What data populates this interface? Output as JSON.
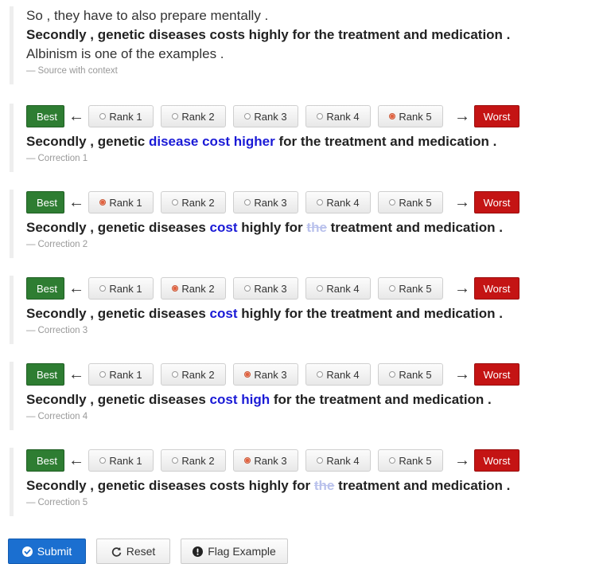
{
  "source": {
    "lines": [
      "So , they have to also prepare mentally .",
      "Secondly , genetic diseases costs highly for the treatment and medication .",
      "Albinism is one of the examples ."
    ],
    "footer": "Source with context"
  },
  "rank_labels": {
    "best": "Best",
    "worst": "Worst",
    "left_arrow": "←",
    "right_arrow": "→",
    "options": [
      "Rank 1",
      "Rank 2",
      "Rank 3",
      "Rank 4",
      "Rank 5"
    ]
  },
  "corrections": [
    {
      "footer": "Correction 1",
      "selected_rank": 5,
      "segments": [
        {
          "t": "Secondly , genetic ",
          "s": "n"
        },
        {
          "t": "disease cost higher",
          "s": "ins"
        },
        {
          "t": " for the treatment and medication .",
          "s": "n"
        }
      ]
    },
    {
      "footer": "Correction 2",
      "selected_rank": 1,
      "segments": [
        {
          "t": "Secondly , genetic diseases ",
          "s": "n"
        },
        {
          "t": "cost",
          "s": "ins"
        },
        {
          "t": " highly for ",
          "s": "n"
        },
        {
          "t": "the",
          "s": "del"
        },
        {
          "t": " treatment and medication .",
          "s": "n"
        }
      ]
    },
    {
      "footer": "Correction 3",
      "selected_rank": 2,
      "segments": [
        {
          "t": "Secondly , genetic diseases ",
          "s": "n"
        },
        {
          "t": "cost",
          "s": "ins"
        },
        {
          "t": " highly for the treatment and medication .",
          "s": "n"
        }
      ]
    },
    {
      "footer": "Correction 4",
      "selected_rank": 3,
      "segments": [
        {
          "t": "Secondly , genetic diseases ",
          "s": "n"
        },
        {
          "t": "cost high",
          "s": "ins"
        },
        {
          "t": " for the treatment and medication .",
          "s": "n"
        }
      ]
    },
    {
      "footer": "Correction 5",
      "selected_rank": 3,
      "segments": [
        {
          "t": "Secondly , genetic diseases costs highly for ",
          "s": "n"
        },
        {
          "t": "the",
          "s": "del"
        },
        {
          "t": " treatment and medication .",
          "s": "n"
        }
      ]
    }
  ],
  "buttons": {
    "submit": "Submit",
    "reset": "Reset",
    "flag": "Flag Example"
  },
  "colors": {
    "best": "#2e7d32",
    "worst": "#c41414",
    "insertion": "#1a1ad6",
    "deletion": "#b9c1ec",
    "submit": "#1b6fd0"
  }
}
